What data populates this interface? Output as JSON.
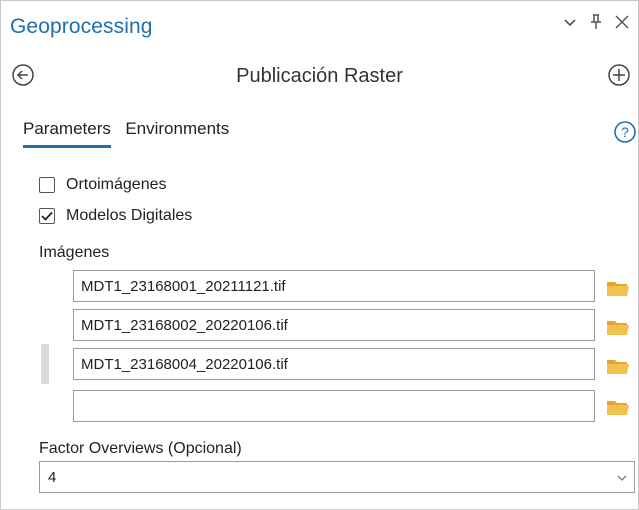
{
  "panel": {
    "title": "Geoprocessing",
    "icons": {
      "dropdown": "chevron-down-icon",
      "pin": "pin-icon",
      "close": "close-icon"
    }
  },
  "tool": {
    "title": "Publicación Raster",
    "back_icon": "back-arrow-circle-icon",
    "add_icon": "add-circle-icon"
  },
  "tabs": [
    {
      "label": "Parameters",
      "active": true
    },
    {
      "label": "Environments",
      "active": false
    }
  ],
  "help_icon": "help-circle-icon",
  "checkboxes": [
    {
      "label": "Ortoimágenes",
      "checked": false
    },
    {
      "label": "Modelos Digitales",
      "checked": true
    }
  ],
  "images": {
    "label": "Imágenes",
    "files": [
      {
        "value": "MDT1_23168001_20211121.tif"
      },
      {
        "value": "MDT1_23168002_20220106.tif"
      },
      {
        "value": "MDT1_23168004_20220106.tif"
      },
      {
        "value": ""
      }
    ]
  },
  "factor_overviews": {
    "label": "Factor Overviews (Opcional)",
    "value": "4"
  },
  "colors": {
    "accent": "#1f6fb0",
    "folder": "#f2c14e",
    "border": "#9a9a9a"
  }
}
